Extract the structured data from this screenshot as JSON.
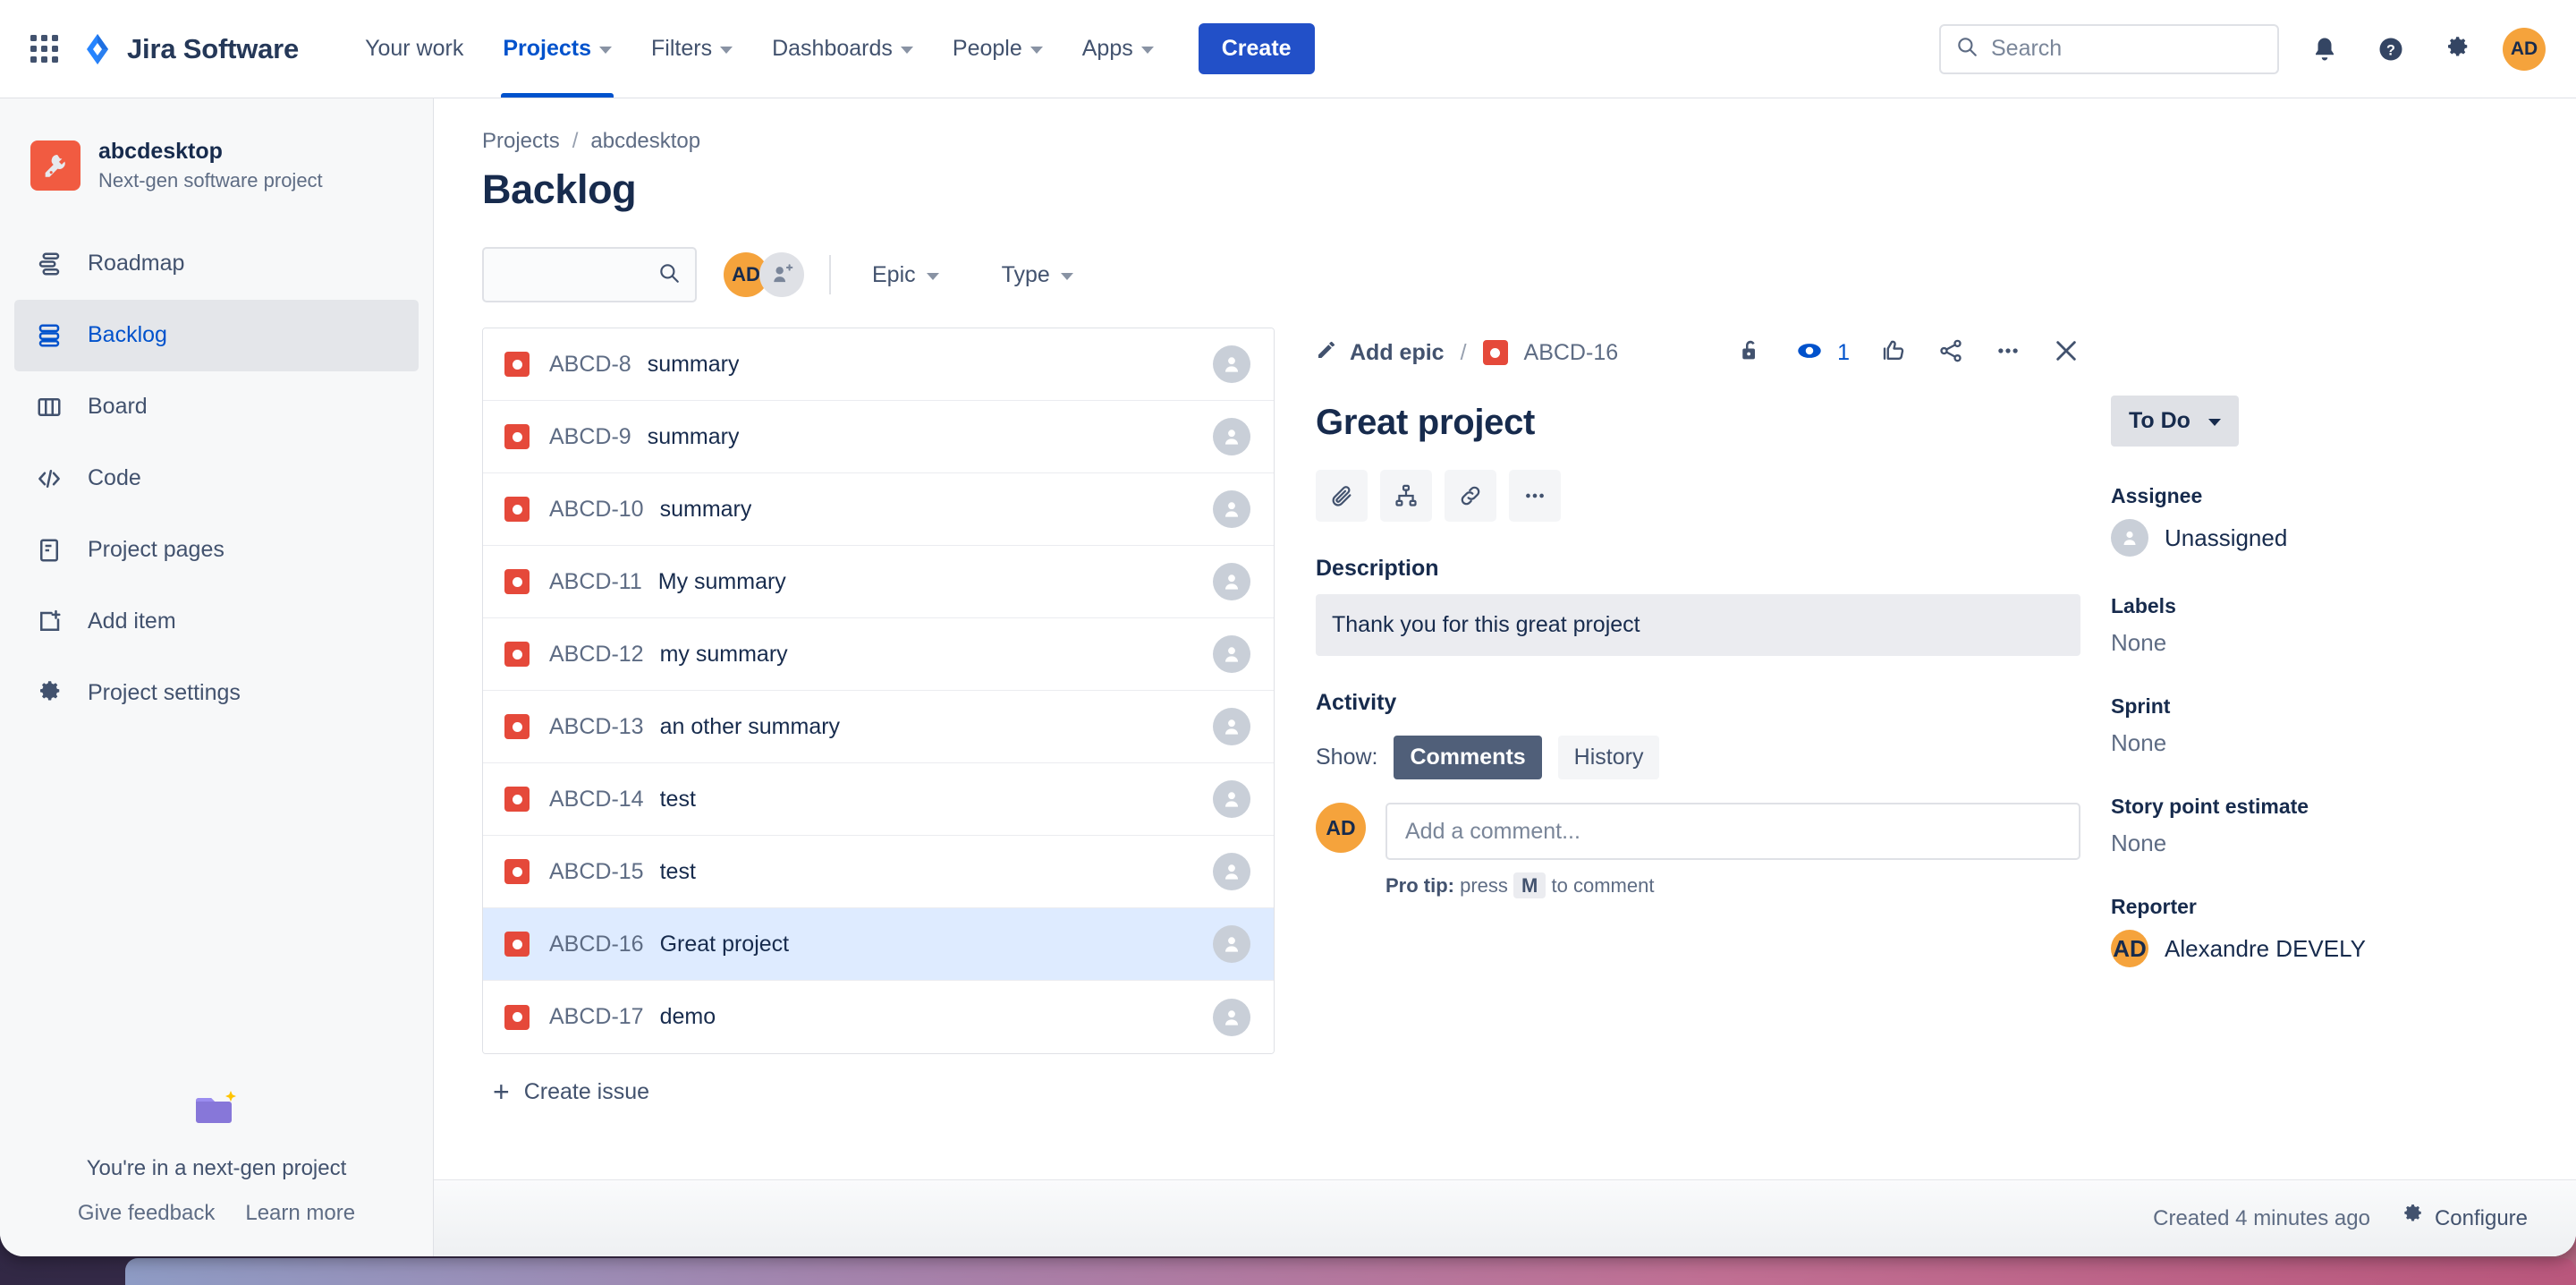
{
  "topnav": {
    "app_switcher_icon": "grid-apps-icon",
    "logo_icon": "jira-diamond-logo",
    "brand": "Jira Software",
    "items": [
      {
        "label": "Your work",
        "has_caret": false,
        "active": false
      },
      {
        "label": "Projects",
        "has_caret": true,
        "active": true
      },
      {
        "label": "Filters",
        "has_caret": true,
        "active": false
      },
      {
        "label": "Dashboards",
        "has_caret": true,
        "active": false
      },
      {
        "label": "People",
        "has_caret": true,
        "active": false
      },
      {
        "label": "Apps",
        "has_caret": true,
        "active": false
      }
    ],
    "create_label": "Create",
    "search_placeholder": "Search",
    "search_value": "",
    "search_icon": "magnifier-icon",
    "notifications_icon": "bell-icon",
    "help_icon": "question-circle-icon",
    "settings_icon": "gear-icon",
    "avatar_initials": "AD",
    "accent_color": "#2250c8"
  },
  "sidebar": {
    "project_name": "abcdesktop",
    "project_type": "Next-gen software project",
    "project_icon": "wrench-icon",
    "project_icon_color": "#f15b41",
    "items": [
      {
        "label": "Roadmap",
        "icon": "roadmap-icon",
        "selected": false
      },
      {
        "label": "Backlog",
        "icon": "backlog-icon",
        "selected": true
      },
      {
        "label": "Board",
        "icon": "board-columns-icon",
        "selected": false
      },
      {
        "label": "Code",
        "icon": "code-brackets-icon",
        "selected": false
      },
      {
        "label": "Project pages",
        "icon": "page-document-icon",
        "selected": false
      },
      {
        "label": "Add item",
        "icon": "add-item-icon",
        "selected": false
      },
      {
        "label": "Project settings",
        "icon": "gear-icon",
        "selected": false
      }
    ],
    "nextgen": {
      "icon": "sparkle-folder-icon",
      "title": "You're in a next-gen project",
      "feedback_label": "Give feedback",
      "learn_label": "Learn more"
    }
  },
  "content": {
    "breadcrumb": {
      "root": "Projects",
      "separator": "/",
      "project": "abcdesktop"
    },
    "page_title": "Backlog",
    "toolbar": {
      "search_value": "",
      "search_placeholder": "",
      "search_icon": "magnifier-icon",
      "avatar_initials": "AD",
      "add_people_icon": "add-person-icon",
      "filters": [
        {
          "label": "Epic",
          "icon": "chevron-down-icon"
        },
        {
          "label": "Type",
          "icon": "chevron-down-icon"
        }
      ]
    },
    "issues": [
      {
        "key": "ABCD-8",
        "summary": "summary",
        "type_icon": "bug-icon",
        "selected": false
      },
      {
        "key": "ABCD-9",
        "summary": "summary",
        "type_icon": "bug-icon",
        "selected": false
      },
      {
        "key": "ABCD-10",
        "summary": "summary",
        "type_icon": "bug-icon",
        "selected": false
      },
      {
        "key": "ABCD-11",
        "summary": "My summary",
        "type_icon": "bug-icon",
        "selected": false
      },
      {
        "key": "ABCD-12",
        "summary": "my summary",
        "type_icon": "bug-icon",
        "selected": false
      },
      {
        "key": "ABCD-13",
        "summary": "an other summary",
        "type_icon": "bug-icon",
        "selected": false
      },
      {
        "key": "ABCD-14",
        "summary": "test",
        "type_icon": "bug-icon",
        "selected": false
      },
      {
        "key": "ABCD-15",
        "summary": "test",
        "type_icon": "bug-icon",
        "selected": false
      },
      {
        "key": "ABCD-16",
        "summary": "Great project",
        "type_icon": "bug-icon",
        "selected": true
      },
      {
        "key": "ABCD-17",
        "summary": "demo",
        "type_icon": "bug-icon",
        "selected": false
      }
    ],
    "create_issue_label": "Create issue",
    "issue_type_color": "#e5493a",
    "selected_row_color": "#deebff"
  },
  "detail": {
    "add_epic_label": "Add epic",
    "add_epic_icon": "pencil-icon",
    "breadcrumb_separator": "/",
    "issue_key": "ABCD-16",
    "issue_type_icon": "bug-icon",
    "header_actions": [
      {
        "name": "lock-open-icon",
        "label": ""
      },
      {
        "name": "watch-eye-icon",
        "label": "1"
      },
      {
        "name": "thumbs-up-icon",
        "label": ""
      },
      {
        "name": "share-icon",
        "label": ""
      },
      {
        "name": "more-actions-icon",
        "label": ""
      },
      {
        "name": "close-icon",
        "label": ""
      }
    ],
    "watch_count": "1",
    "title": "Great project",
    "action_buttons": [
      {
        "name": "attach-icon"
      },
      {
        "name": "child-issue-icon"
      },
      {
        "name": "link-icon"
      },
      {
        "name": "more-icon"
      }
    ],
    "description_label": "Description",
    "description_text": "Thank you for this great project",
    "activity_label": "Activity",
    "show_label": "Show:",
    "tabs": [
      {
        "label": "Comments",
        "active": true
      },
      {
        "label": "History",
        "active": false
      }
    ],
    "comment_avatar_initials": "AD",
    "comment_placeholder": "Add a comment...",
    "comment_value": "",
    "protip_prefix": "Pro tip:",
    "protip_mid": "press",
    "protip_key": "M",
    "protip_suffix": "to comment"
  },
  "fields": {
    "status": {
      "value": "To Do",
      "icon": "chevron-down-icon"
    },
    "assignee": {
      "label": "Assignee",
      "value": "Unassigned",
      "avatar": "person-placeholder-icon"
    },
    "labels": {
      "label": "Labels",
      "value": "None"
    },
    "sprint": {
      "label": "Sprint",
      "value": "None"
    },
    "story_points": {
      "label": "Story point estimate",
      "value": "None"
    },
    "reporter": {
      "label": "Reporter",
      "value": "Alexandre DEVELY",
      "avatar_initials": "AD"
    }
  },
  "footer": {
    "created_text": "Created 4 minutes ago",
    "configure_label": "Configure",
    "configure_icon": "gear-icon"
  }
}
